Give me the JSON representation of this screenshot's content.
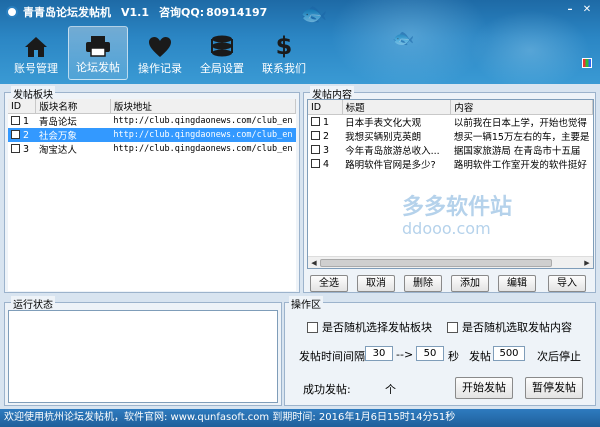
{
  "app": {
    "title": "青青岛论坛发帖机",
    "version": "V1.1",
    "qq_label": "咨询QQ:",
    "qq_number": "80914197"
  },
  "nav": {
    "items": [
      {
        "label": "账号管理",
        "icon": "home-icon"
      },
      {
        "label": "论坛发帖",
        "icon": "printer-icon",
        "active": true
      },
      {
        "label": "操作记录",
        "icon": "heart-icon"
      },
      {
        "label": "全局设置",
        "icon": "coins-icon"
      },
      {
        "label": "联系我们",
        "icon": "dollar-icon"
      }
    ]
  },
  "boards": {
    "title": "发帖板块",
    "columns": [
      "ID",
      "版块名称",
      "版块地址"
    ],
    "rows": [
      {
        "id": "1",
        "name": "青岛论坛",
        "url": "http://club.qingdaonews.com/club_en"
      },
      {
        "id": "2",
        "name": "社会万象",
        "url": "http://club.qingdaonews.com/club_en",
        "selected": true
      },
      {
        "id": "3",
        "name": "淘宝达人",
        "url": "http://club.qingdaonews.com/club_en"
      }
    ]
  },
  "posts": {
    "title": "发帖内容",
    "columns": [
      "ID",
      "标题",
      "内容"
    ],
    "rows": [
      {
        "id": "1",
        "title": "日本手表文化大观",
        "content": "以前我在日本上学，开始也觉得"
      },
      {
        "id": "2",
        "title": "我想买辆别克英朗",
        "content": "想买一辆15万左右的车，主要是"
      },
      {
        "id": "3",
        "title": "今年青岛旅游总收入...",
        "content": "据国家旅游局  在青岛市十五届"
      },
      {
        "id": "4",
        "title": "路明软件官网是多少?",
        "content": "路明软件工作室开发的软件挺好"
      }
    ],
    "buttons": [
      "全选",
      "取消",
      "删除",
      "添加",
      "编辑",
      "导入"
    ]
  },
  "run_status": {
    "title": "运行状态"
  },
  "ops": {
    "title": "操作区",
    "random_board": "是否随机选择发帖板块",
    "random_content": "是否随机选取发帖内容",
    "interval_label": "发帖时间间隔",
    "interval_from": "30",
    "interval_arrow": "-->",
    "interval_to": "50",
    "seconds_unit": "秒",
    "post_label": "发帖",
    "post_count": "500",
    "stop_after": "次后停止",
    "success_label": "成功发帖:",
    "success_unit": "个",
    "start_button": "开始发帖",
    "pause_button": "暂停发帖"
  },
  "statusbar": {
    "text": "欢迎使用杭州论坛发帖机，软件官网: www.qunfasoft.com  到期时间: 2016年1月6日15时14分51秒"
  },
  "watermark": {
    "cn": "多多软件站",
    "en": "ddooo.com"
  },
  "colors": {
    "header": "#2b86c4",
    "selection": "#3399ff",
    "statusbar": "#1f5f9a"
  }
}
